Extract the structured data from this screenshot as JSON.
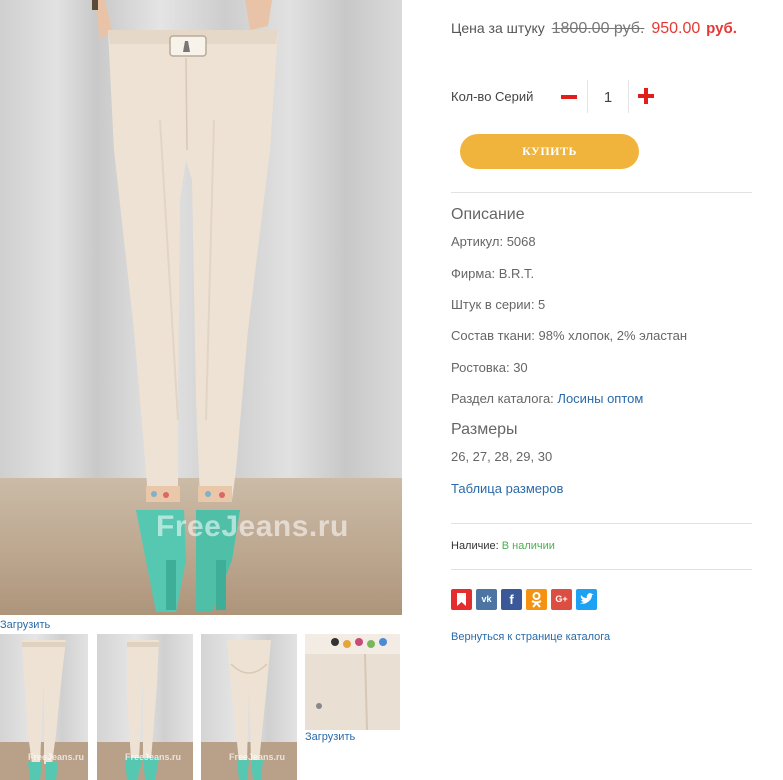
{
  "gallery": {
    "main_watermark": "FreeJeans.ru",
    "main_caption": "Загрузить",
    "thumbs": [
      {
        "watermark": "FreeJeans.ru"
      },
      {
        "watermark": "FreeJeans.ru"
      },
      {
        "watermark": "FreeJeans.ru"
      },
      {
        "caption": "Загрузить"
      }
    ]
  },
  "price": {
    "label": "Цена за штуку",
    "old": "1800.00 руб.",
    "new": "950.00",
    "currency": "руб."
  },
  "quantity": {
    "label": "Кол-во Серий",
    "value": "1"
  },
  "buy_button": "КУПИТЬ",
  "description": {
    "title": "Описание",
    "article": "Артикул: 5068",
    "brand": "Фирма: B.R.T.",
    "pieces": "Штук в серии: 5",
    "fabric": "Состав ткани: 98% хлопок, 2% эластан",
    "size_range": "Ростовка: 30",
    "catalog_label": "Раздел каталога:",
    "catalog_link": "Лосины оптом"
  },
  "sizes": {
    "title": "Размеры",
    "values": "26, 27, 28, 29, 30",
    "table_link": "Таблица размеров"
  },
  "availability": {
    "label": "Наличие:",
    "value": "В наличии"
  },
  "share": [
    {
      "icon": "bookmark-icon",
      "color": "#e52d2d"
    },
    {
      "icon": "vk-icon",
      "color": "#4c75a3"
    },
    {
      "icon": "facebook-icon",
      "color": "#3b5998"
    },
    {
      "icon": "odnoklassniki-icon",
      "color": "#f59311"
    },
    {
      "icon": "google-plus-icon",
      "color": "#dc4e41"
    },
    {
      "icon": "twitter-icon",
      "color": "#1da1f2"
    }
  ],
  "back_link": "Вернуться к странице каталога"
}
